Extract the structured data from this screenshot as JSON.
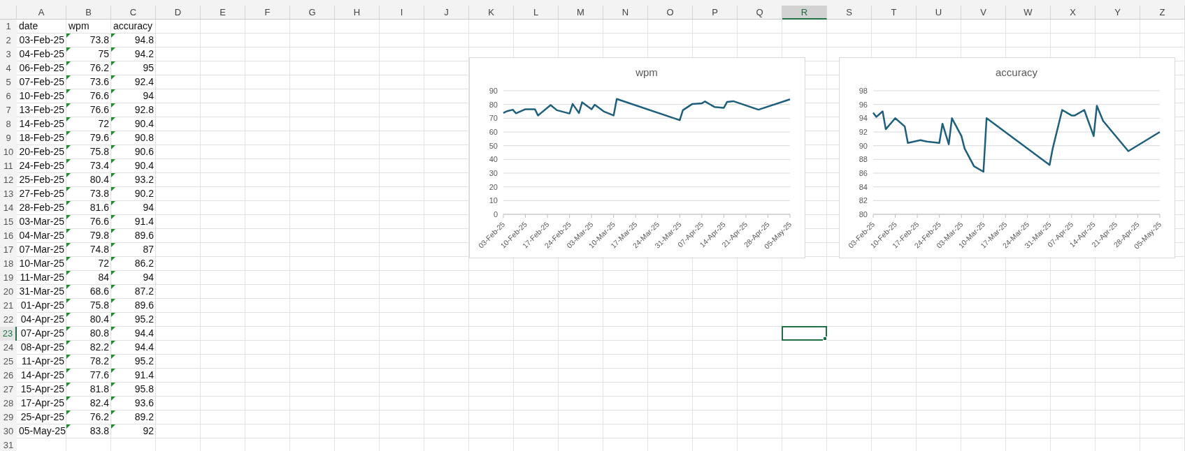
{
  "columns": [
    {
      "label": "A",
      "selected": false
    },
    {
      "label": "B",
      "selected": false
    },
    {
      "label": "C",
      "selected": false
    },
    {
      "label": "D",
      "selected": false
    },
    {
      "label": "E",
      "selected": false
    },
    {
      "label": "F",
      "selected": false
    },
    {
      "label": "G",
      "selected": false
    },
    {
      "label": "H",
      "selected": false
    },
    {
      "label": "I",
      "selected": false
    },
    {
      "label": "J",
      "selected": false
    },
    {
      "label": "K",
      "selected": false
    },
    {
      "label": "L",
      "selected": false
    },
    {
      "label": "M",
      "selected": false
    },
    {
      "label": "N",
      "selected": false
    },
    {
      "label": "O",
      "selected": false
    },
    {
      "label": "P",
      "selected": false
    },
    {
      "label": "Q",
      "selected": false
    },
    {
      "label": "R",
      "selected": true
    },
    {
      "label": "S",
      "selected": false
    },
    {
      "label": "T",
      "selected": false
    },
    {
      "label": "U",
      "selected": false
    },
    {
      "label": "V",
      "selected": false
    },
    {
      "label": "W",
      "selected": false
    },
    {
      "label": "X",
      "selected": false
    },
    {
      "label": "Y",
      "selected": false
    },
    {
      "label": "Z",
      "selected": false
    }
  ],
  "rows": [
    {
      "number": "1",
      "selected": false,
      "kind": "text",
      "cells": [
        {
          "text": "date",
          "warning": false
        },
        {
          "text": "wpm",
          "warning": false
        },
        {
          "text": "accuracy",
          "warning": false
        }
      ]
    },
    {
      "number": "2",
      "selected": false,
      "kind": "values",
      "cells": [
        {
          "text": "03-Feb-25",
          "warning": false
        },
        {
          "text": "73.8",
          "warning": true
        },
        {
          "text": "94.8",
          "warning": true
        }
      ]
    },
    {
      "number": "3",
      "selected": false,
      "kind": "values",
      "cells": [
        {
          "text": "04-Feb-25",
          "warning": false
        },
        {
          "text": "75",
          "warning": true
        },
        {
          "text": "94.2",
          "warning": true
        }
      ]
    },
    {
      "number": "4",
      "selected": false,
      "kind": "values",
      "cells": [
        {
          "text": "06-Feb-25",
          "warning": false
        },
        {
          "text": "76.2",
          "warning": true
        },
        {
          "text": "95",
          "warning": true
        }
      ]
    },
    {
      "number": "5",
      "selected": false,
      "kind": "values",
      "cells": [
        {
          "text": "07-Feb-25",
          "warning": false
        },
        {
          "text": "73.6",
          "warning": true
        },
        {
          "text": "92.4",
          "warning": true
        }
      ]
    },
    {
      "number": "6",
      "selected": false,
      "kind": "values",
      "cells": [
        {
          "text": "10-Feb-25",
          "warning": false
        },
        {
          "text": "76.6",
          "warning": true
        },
        {
          "text": "94",
          "warning": true
        }
      ]
    },
    {
      "number": "7",
      "selected": false,
      "kind": "values",
      "cells": [
        {
          "text": "13-Feb-25",
          "warning": false
        },
        {
          "text": "76.6",
          "warning": true
        },
        {
          "text": "92.8",
          "warning": true
        }
      ]
    },
    {
      "number": "8",
      "selected": false,
      "kind": "values",
      "cells": [
        {
          "text": "14-Feb-25",
          "warning": false
        },
        {
          "text": "72",
          "warning": true
        },
        {
          "text": "90.4",
          "warning": true
        }
      ]
    },
    {
      "number": "9",
      "selected": false,
      "kind": "values",
      "cells": [
        {
          "text": "18-Feb-25",
          "warning": false
        },
        {
          "text": "79.6",
          "warning": true
        },
        {
          "text": "90.8",
          "warning": true
        }
      ]
    },
    {
      "number": "10",
      "selected": false,
      "kind": "values",
      "cells": [
        {
          "text": "20-Feb-25",
          "warning": false
        },
        {
          "text": "75.8",
          "warning": true
        },
        {
          "text": "90.6",
          "warning": true
        }
      ]
    },
    {
      "number": "11",
      "selected": false,
      "kind": "values",
      "cells": [
        {
          "text": "24-Feb-25",
          "warning": false
        },
        {
          "text": "73.4",
          "warning": true
        },
        {
          "text": "90.4",
          "warning": true
        }
      ]
    },
    {
      "number": "12",
      "selected": false,
      "kind": "values",
      "cells": [
        {
          "text": "25-Feb-25",
          "warning": false
        },
        {
          "text": "80.4",
          "warning": true
        },
        {
          "text": "93.2",
          "warning": true
        }
      ]
    },
    {
      "number": "13",
      "selected": false,
      "kind": "values",
      "cells": [
        {
          "text": "27-Feb-25",
          "warning": false
        },
        {
          "text": "73.8",
          "warning": true
        },
        {
          "text": "90.2",
          "warning": true
        }
      ]
    },
    {
      "number": "14",
      "selected": false,
      "kind": "values",
      "cells": [
        {
          "text": "28-Feb-25",
          "warning": false
        },
        {
          "text": "81.6",
          "warning": true
        },
        {
          "text": "94",
          "warning": true
        }
      ]
    },
    {
      "number": "15",
      "selected": false,
      "kind": "values",
      "cells": [
        {
          "text": "03-Mar-25",
          "warning": false
        },
        {
          "text": "76.6",
          "warning": true
        },
        {
          "text": "91.4",
          "warning": true
        }
      ]
    },
    {
      "number": "16",
      "selected": false,
      "kind": "values",
      "cells": [
        {
          "text": "04-Mar-25",
          "warning": false
        },
        {
          "text": "79.8",
          "warning": true
        },
        {
          "text": "89.6",
          "warning": true
        }
      ]
    },
    {
      "number": "17",
      "selected": false,
      "kind": "values",
      "cells": [
        {
          "text": "07-Mar-25",
          "warning": false
        },
        {
          "text": "74.8",
          "warning": true
        },
        {
          "text": "87",
          "warning": true
        }
      ]
    },
    {
      "number": "18",
      "selected": false,
      "kind": "values",
      "cells": [
        {
          "text": "10-Mar-25",
          "warning": false
        },
        {
          "text": "72",
          "warning": true
        },
        {
          "text": "86.2",
          "warning": true
        }
      ]
    },
    {
      "number": "19",
      "selected": false,
      "kind": "values",
      "cells": [
        {
          "text": "11-Mar-25",
          "warning": false
        },
        {
          "text": "84",
          "warning": true
        },
        {
          "text": "94",
          "warning": true
        }
      ]
    },
    {
      "number": "20",
      "selected": false,
      "kind": "values",
      "cells": [
        {
          "text": "31-Mar-25",
          "warning": false
        },
        {
          "text": "68.6",
          "warning": true
        },
        {
          "text": "87.2",
          "warning": true
        }
      ]
    },
    {
      "number": "21",
      "selected": false,
      "kind": "values",
      "cells": [
        {
          "text": "01-Apr-25",
          "warning": false
        },
        {
          "text": "75.8",
          "warning": true
        },
        {
          "text": "89.6",
          "warning": true
        }
      ]
    },
    {
      "number": "22",
      "selected": false,
      "kind": "values",
      "cells": [
        {
          "text": "04-Apr-25",
          "warning": false
        },
        {
          "text": "80.4",
          "warning": true
        },
        {
          "text": "95.2",
          "warning": true
        }
      ]
    },
    {
      "number": "23",
      "selected": true,
      "kind": "values",
      "cells": [
        {
          "text": "07-Apr-25",
          "warning": false
        },
        {
          "text": "80.8",
          "warning": true
        },
        {
          "text": "94.4",
          "warning": true
        }
      ]
    },
    {
      "number": "24",
      "selected": false,
      "kind": "values",
      "cells": [
        {
          "text": "08-Apr-25",
          "warning": false
        },
        {
          "text": "82.2",
          "warning": true
        },
        {
          "text": "94.4",
          "warning": true
        }
      ]
    },
    {
      "number": "25",
      "selected": false,
      "kind": "values",
      "cells": [
        {
          "text": "11-Apr-25",
          "warning": false
        },
        {
          "text": "78.2",
          "warning": true
        },
        {
          "text": "95.2",
          "warning": true
        }
      ]
    },
    {
      "number": "26",
      "selected": false,
      "kind": "values",
      "cells": [
        {
          "text": "14-Apr-25",
          "warning": false
        },
        {
          "text": "77.6",
          "warning": true
        },
        {
          "text": "91.4",
          "warning": true
        }
      ]
    },
    {
      "number": "27",
      "selected": false,
      "kind": "values",
      "cells": [
        {
          "text": "15-Apr-25",
          "warning": false
        },
        {
          "text": "81.8",
          "warning": true
        },
        {
          "text": "95.8",
          "warning": true
        }
      ]
    },
    {
      "number": "28",
      "selected": false,
      "kind": "values",
      "cells": [
        {
          "text": "17-Apr-25",
          "warning": false
        },
        {
          "text": "82.4",
          "warning": true
        },
        {
          "text": "93.6",
          "warning": true
        }
      ]
    },
    {
      "number": "29",
      "selected": false,
      "kind": "values",
      "cells": [
        {
          "text": "25-Apr-25",
          "warning": false
        },
        {
          "text": "76.2",
          "warning": true
        },
        {
          "text": "89.2",
          "warning": true
        }
      ]
    },
    {
      "number": "30",
      "selected": false,
      "kind": "values",
      "cells": [
        {
          "text": "05-May-25",
          "warning": false
        },
        {
          "text": "83.8",
          "warning": true
        },
        {
          "text": "92",
          "warning": true
        }
      ]
    },
    {
      "number": "31",
      "selected": false,
      "cells": []
    }
  ],
  "charts": [
    {
      "chart_data": {
        "type": "line",
        "title": "wpm",
        "grid": true,
        "ylim": [
          0,
          90
        ],
        "categories": [
          "03-Feb-25",
          null,
          null,
          null,
          null,
          null,
          null,
          "10-Feb-25",
          null,
          null,
          null,
          null,
          null,
          null,
          "17-Feb-25",
          null,
          null,
          null,
          null,
          null,
          null,
          "24-Feb-25",
          null,
          null,
          null,
          null,
          null,
          null,
          "03-Mar-25",
          null,
          null,
          null,
          null,
          null,
          null,
          "10-Mar-25",
          null,
          null,
          null,
          null,
          null,
          null,
          "17-Mar-25",
          null,
          null,
          null,
          null,
          null,
          null,
          "24-Mar-25",
          null,
          null,
          null,
          null,
          null,
          null,
          "31-Mar-25",
          null,
          null,
          null,
          null,
          null,
          null,
          "07-Apr-25",
          null,
          null,
          null,
          null,
          null,
          null,
          "14-Apr-25",
          null,
          null,
          null,
          null,
          null,
          null,
          "21-Apr-25",
          null,
          null,
          null,
          null,
          null,
          null,
          "28-Apr-25",
          null,
          null,
          null,
          null,
          null,
          null,
          "05-May-25"
        ],
        "yticks": [
          0,
          10,
          20,
          30,
          40,
          50,
          60,
          70,
          80,
          90
        ],
        "series": [
          {
            "color": "#1f5f7e",
            "values": [
              73.8,
              75,
              null,
              76.2,
              73.6,
              null,
              null,
              76.6,
              null,
              null,
              76.6,
              72,
              null,
              null,
              null,
              79.6,
              null,
              75.8,
              null,
              null,
              null,
              73.4,
              80.4,
              null,
              73.8,
              81.6,
              null,
              null,
              76.6,
              79.8,
              null,
              null,
              74.8,
              null,
              null,
              72,
              84,
              null,
              null,
              null,
              null,
              null,
              null,
              null,
              null,
              null,
              null,
              null,
              null,
              null,
              null,
              null,
              null,
              null,
              null,
              null,
              68.6,
              75.8,
              null,
              null,
              80.4,
              null,
              null,
              80.8,
              82.2,
              null,
              null,
              78.2,
              null,
              null,
              77.6,
              81.8,
              null,
              82.4,
              null,
              null,
              null,
              null,
              null,
              null,
              null,
              76.2,
              null,
              null,
              null,
              null,
              null,
              null,
              null,
              null,
              null,
              83.8
            ]
          }
        ]
      }
    },
    {
      "chart_data": {
        "type": "line",
        "title": "accuracy",
        "grid": true,
        "ylim": [
          80,
          98
        ],
        "categories": [
          "03-Feb-25",
          null,
          null,
          null,
          null,
          null,
          null,
          "10-Feb-25",
          null,
          null,
          null,
          null,
          null,
          null,
          "17-Feb-25",
          null,
          null,
          null,
          null,
          null,
          null,
          "24-Feb-25",
          null,
          null,
          null,
          null,
          null,
          null,
          "03-Mar-25",
          null,
          null,
          null,
          null,
          null,
          null,
          "10-Mar-25",
          null,
          null,
          null,
          null,
          null,
          null,
          "17-Mar-25",
          null,
          null,
          null,
          null,
          null,
          null,
          "24-Mar-25",
          null,
          null,
          null,
          null,
          null,
          null,
          "31-Mar-25",
          null,
          null,
          null,
          null,
          null,
          null,
          "07-Apr-25",
          null,
          null,
          null,
          null,
          null,
          null,
          "14-Apr-25",
          null,
          null,
          null,
          null,
          null,
          null,
          "21-Apr-25",
          null,
          null,
          null,
          null,
          null,
          null,
          "28-Apr-25",
          null,
          null,
          null,
          null,
          null,
          null,
          "05-May-25"
        ],
        "yticks": [
          80,
          82,
          84,
          86,
          88,
          90,
          92,
          94,
          96,
          98
        ],
        "series": [
          {
            "color": "#1f5f7e",
            "values": [
              94.8,
              94.2,
              null,
              95,
              92.4,
              null,
              null,
              94,
              null,
              null,
              92.8,
              90.4,
              null,
              null,
              null,
              90.8,
              null,
              90.6,
              null,
              null,
              null,
              90.4,
              93.2,
              null,
              90.2,
              94,
              null,
              null,
              91.4,
              89.6,
              null,
              null,
              87,
              null,
              null,
              86.2,
              94,
              null,
              null,
              null,
              null,
              null,
              null,
              null,
              null,
              null,
              null,
              null,
              null,
              null,
              null,
              null,
              null,
              null,
              null,
              null,
              87.2,
              89.6,
              null,
              null,
              95.2,
              null,
              null,
              94.4,
              94.4,
              null,
              null,
              95.2,
              null,
              null,
              91.4,
              95.8,
              null,
              93.6,
              null,
              null,
              null,
              null,
              null,
              null,
              null,
              89.2,
              null,
              null,
              null,
              null,
              null,
              null,
              null,
              null,
              null,
              92
            ]
          }
        ]
      }
    }
  ]
}
